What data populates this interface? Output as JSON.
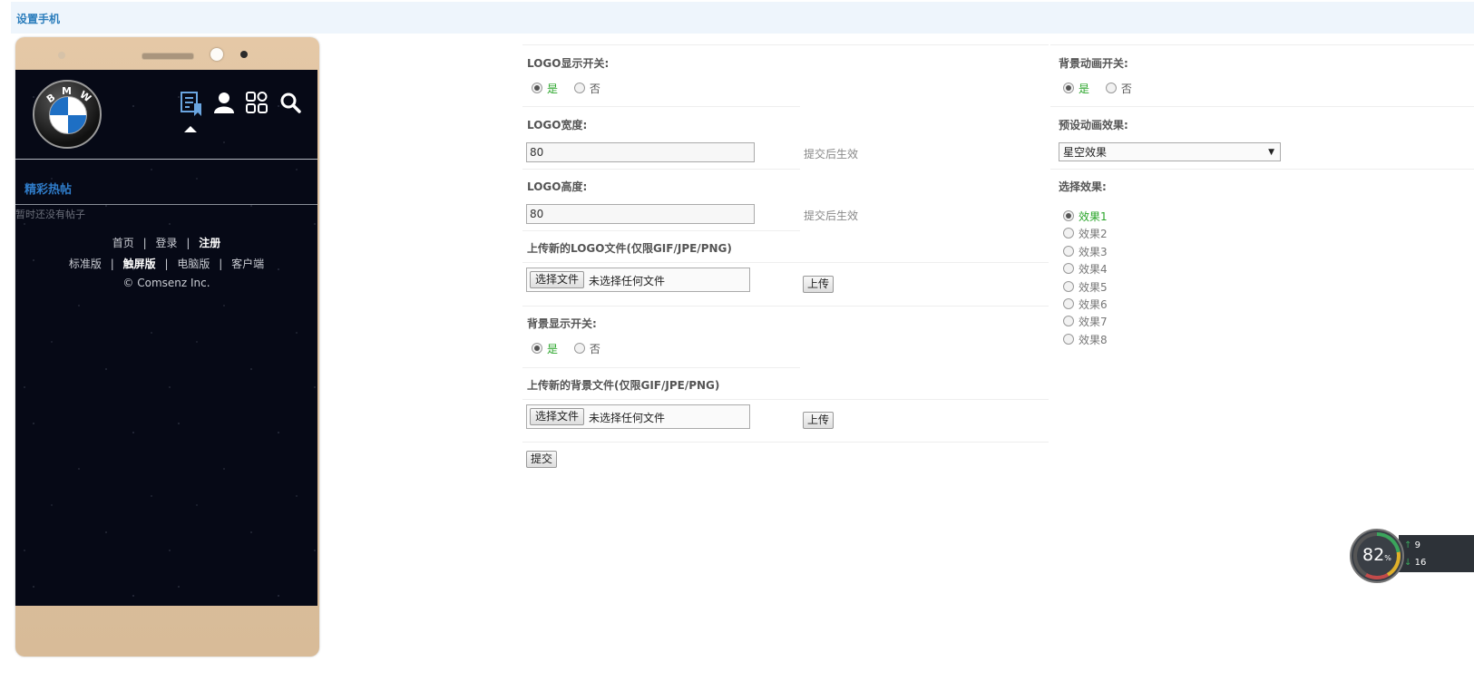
{
  "header": {
    "title": "设置手机"
  },
  "phone": {
    "logo_letters": [
      "B",
      "M",
      "W"
    ],
    "icons": [
      "document-bookmark-icon",
      "user-icon",
      "apps-grid-icon",
      "search-icon"
    ],
    "hot_title": "精彩热帖",
    "empty_text": "暂时还没有帖子",
    "nav1": [
      "首页",
      "登录",
      "注册"
    ],
    "nav2": [
      "标准版",
      "触屏版",
      "电脑版",
      "客户端"
    ],
    "separator": "|",
    "copyright": "© Comsenz Inc."
  },
  "form": {
    "logo_switch": {
      "label": "LOGO显示开关:",
      "yes": "是",
      "no": "否",
      "selected": "yes"
    },
    "logo_width": {
      "label": "LOGO宽度:",
      "value": "80",
      "hint": "提交后生效"
    },
    "logo_height": {
      "label": "LOGO高度:",
      "value": "80",
      "hint": "提交后生效"
    },
    "logo_upload": {
      "label": "上传新的LOGO文件(仅限GIF/JPE/PNG)",
      "choose": "选择文件",
      "none": "未选择任何文件",
      "upload": "上传"
    },
    "bg_switch": {
      "label": "背景显示开关:",
      "yes": "是",
      "no": "否",
      "selected": "yes"
    },
    "bg_upload": {
      "label": "上传新的背景文件(仅限GIF/JPE/PNG)",
      "choose": "选择文件",
      "none": "未选择任何文件",
      "upload": "上传"
    },
    "submit": "提交"
  },
  "right": {
    "anim_switch": {
      "label": "背景动画开关:",
      "yes": "是",
      "no": "否",
      "selected": "yes"
    },
    "preset": {
      "label": "预设动画效果:",
      "value": "星空效果"
    },
    "effects_label": "选择效果:",
    "effects": [
      "效果1",
      "效果2",
      "效果3",
      "效果4",
      "效果5",
      "效果6",
      "效果7",
      "效果8"
    ],
    "selected_effect": 0
  },
  "netmon": {
    "percent": "82",
    "unit": "%",
    "up": "9",
    "down": "16"
  },
  "colors": {
    "accent": "#2b7dbc",
    "yes": "#2aa52a",
    "phone_gold": "#dcc09f",
    "screen": "#060916"
  }
}
